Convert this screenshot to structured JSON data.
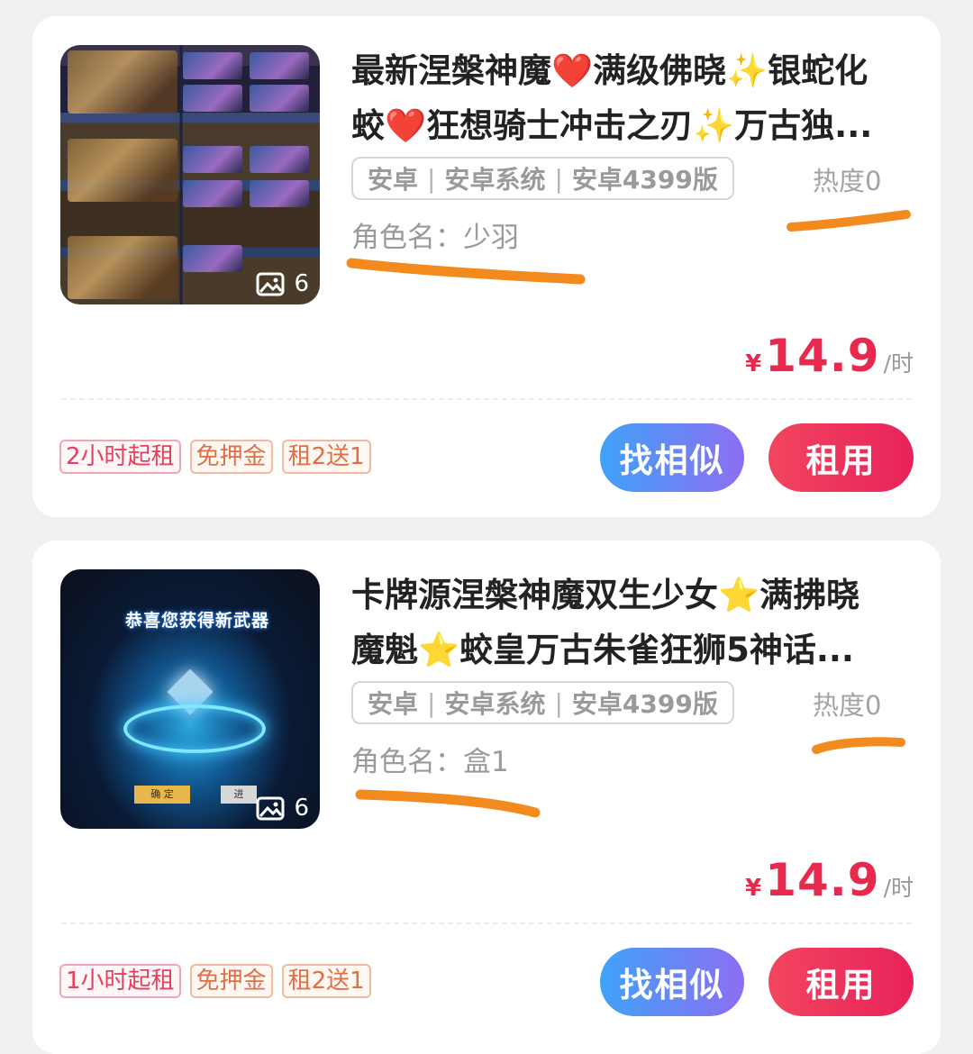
{
  "listings": [
    {
      "title_line1": "最新涅槃神魔❤️满级佛晓✨银蛇化",
      "title_line2": "蛟❤️狂想骑士冲击之刃✨万古独...",
      "photo_count": "6",
      "platform_tags": [
        "安卓",
        "安卓系统",
        "安卓4399版"
      ],
      "heat": "热度0",
      "role": "角色名：少羽",
      "price_symbol": "¥",
      "price": "14.9",
      "price_unit": "/时",
      "badges": [
        "2小时起租",
        "免押金",
        "租2送1"
      ],
      "similar_label": "找相似",
      "rent_label": "租用"
    },
    {
      "title_line1": "卡牌源涅槃神魔双生少女⭐满拂晓",
      "title_line2": "魔魁⭐蛟皇万古朱雀狂狮5神话...",
      "photo_count": "6",
      "platform_tags": [
        "安卓",
        "安卓系统",
        "安卓4399版"
      ],
      "heat": "热度0",
      "role": "角色名：盒1",
      "price_symbol": "¥",
      "price": "14.9",
      "price_unit": "/时",
      "badges": [
        "1小时起租",
        "免押金",
        "租2送1"
      ],
      "similar_label": "找相似",
      "rent_label": "租用",
      "thumb_banner": "恭喜您获得新武器",
      "thumb_confirm": "确 定",
      "thumb_next": "进"
    }
  ],
  "colors": {
    "price": "#e8284d",
    "rent_button": "#ef3a5d",
    "similar_button_start": "#3fa2f8",
    "similar_button_end": "#8d6ef2",
    "scribble": "#f28a1e"
  }
}
